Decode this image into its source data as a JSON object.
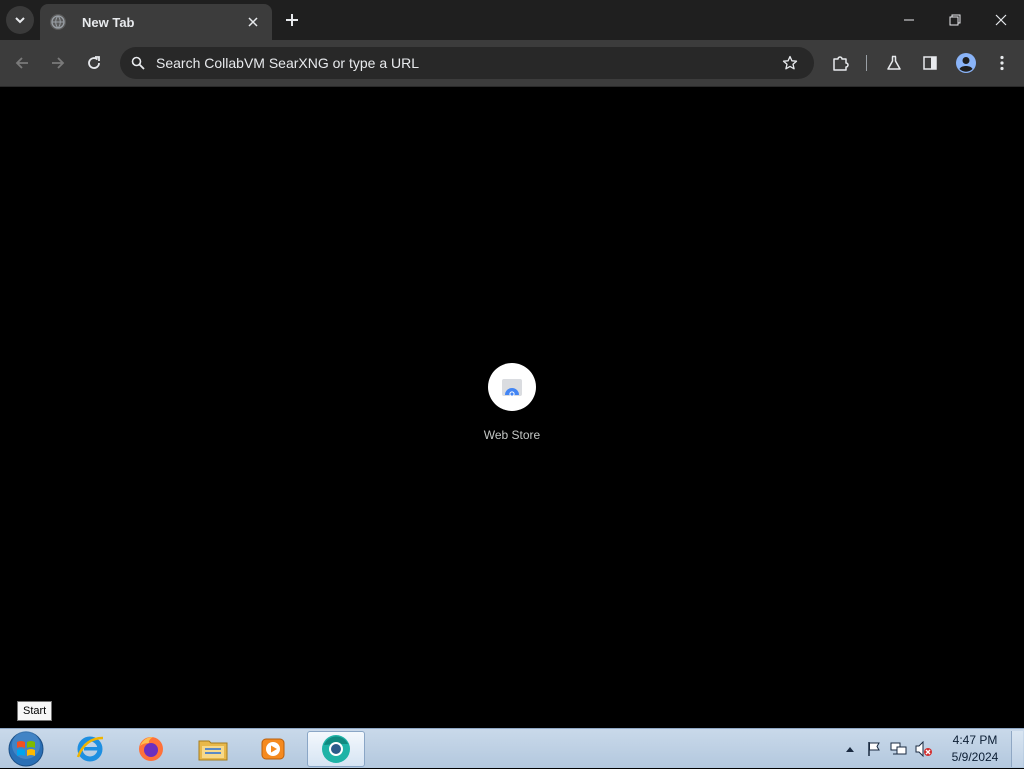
{
  "browser": {
    "tab": {
      "title": "New Tab"
    },
    "omnibox": {
      "placeholder": "Search CollabVM SearXNG or type a URL"
    },
    "icons": {
      "tab_search": "chevron-down-icon",
      "new_tab": "plus-icon",
      "back": "arrow-left-icon",
      "forward": "arrow-right-icon",
      "reload": "reload-icon",
      "bookmark": "star-icon",
      "extensions": "puzzle-icon",
      "labs": "flask-icon",
      "side_panel": "side-panel-icon",
      "profile": "avatar-icon",
      "menu": "kebab-menu-icon"
    }
  },
  "shortcuts": [
    {
      "label": "Web Store"
    }
  ],
  "taskbar": {
    "start_tooltip": "Start",
    "apps": [
      "Internet Explorer",
      "Firefox",
      "Windows Explorer",
      "Windows Media Player",
      "Chromium"
    ],
    "clock": {
      "time": "4:47 PM",
      "date": "5/9/2024"
    }
  },
  "colors": {
    "tabstrip": "#1f1f1f",
    "toolbar": "#3c3c3c",
    "omnibox": "#282828",
    "content": "#000000",
    "profile_accent": "#8ab4f8"
  }
}
